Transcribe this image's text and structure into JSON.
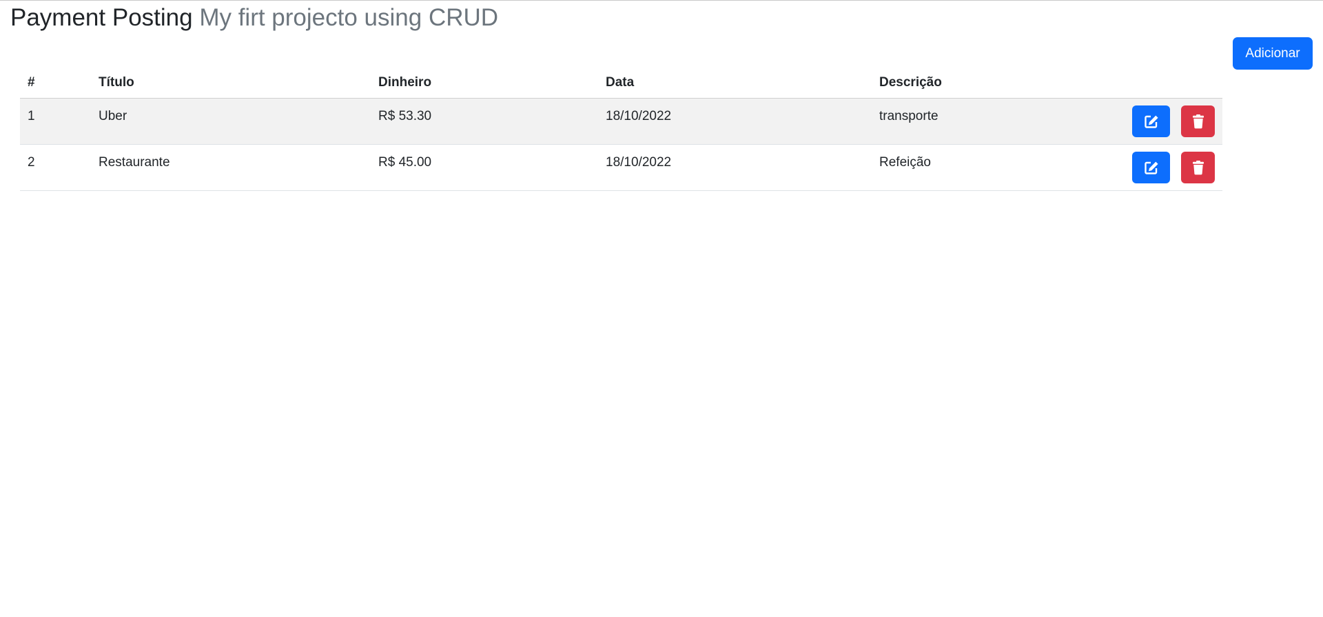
{
  "header": {
    "title": "Payment Posting",
    "subtitle": "My firt projecto using CRUD"
  },
  "toolbar": {
    "add_label": "Adicionar"
  },
  "table": {
    "columns": [
      "#",
      "Título",
      "Dinheiro",
      "Data",
      "Descrição"
    ],
    "rows": [
      {
        "id": "1",
        "title": "Uber",
        "money": "R$ 53.30",
        "date": "18/10/2022",
        "description": "transporte"
      },
      {
        "id": "2",
        "title": "Restaurante",
        "money": "R$ 45.00",
        "date": "18/10/2022",
        "description": "Refeição"
      }
    ],
    "edit_icon": "edit-icon",
    "delete_icon": "trash-icon"
  },
  "colors": {
    "primary": "#0d6efd",
    "danger": "#dc3545",
    "subtitle": "#6c757d",
    "row_stripe": "#f2f2f2"
  }
}
